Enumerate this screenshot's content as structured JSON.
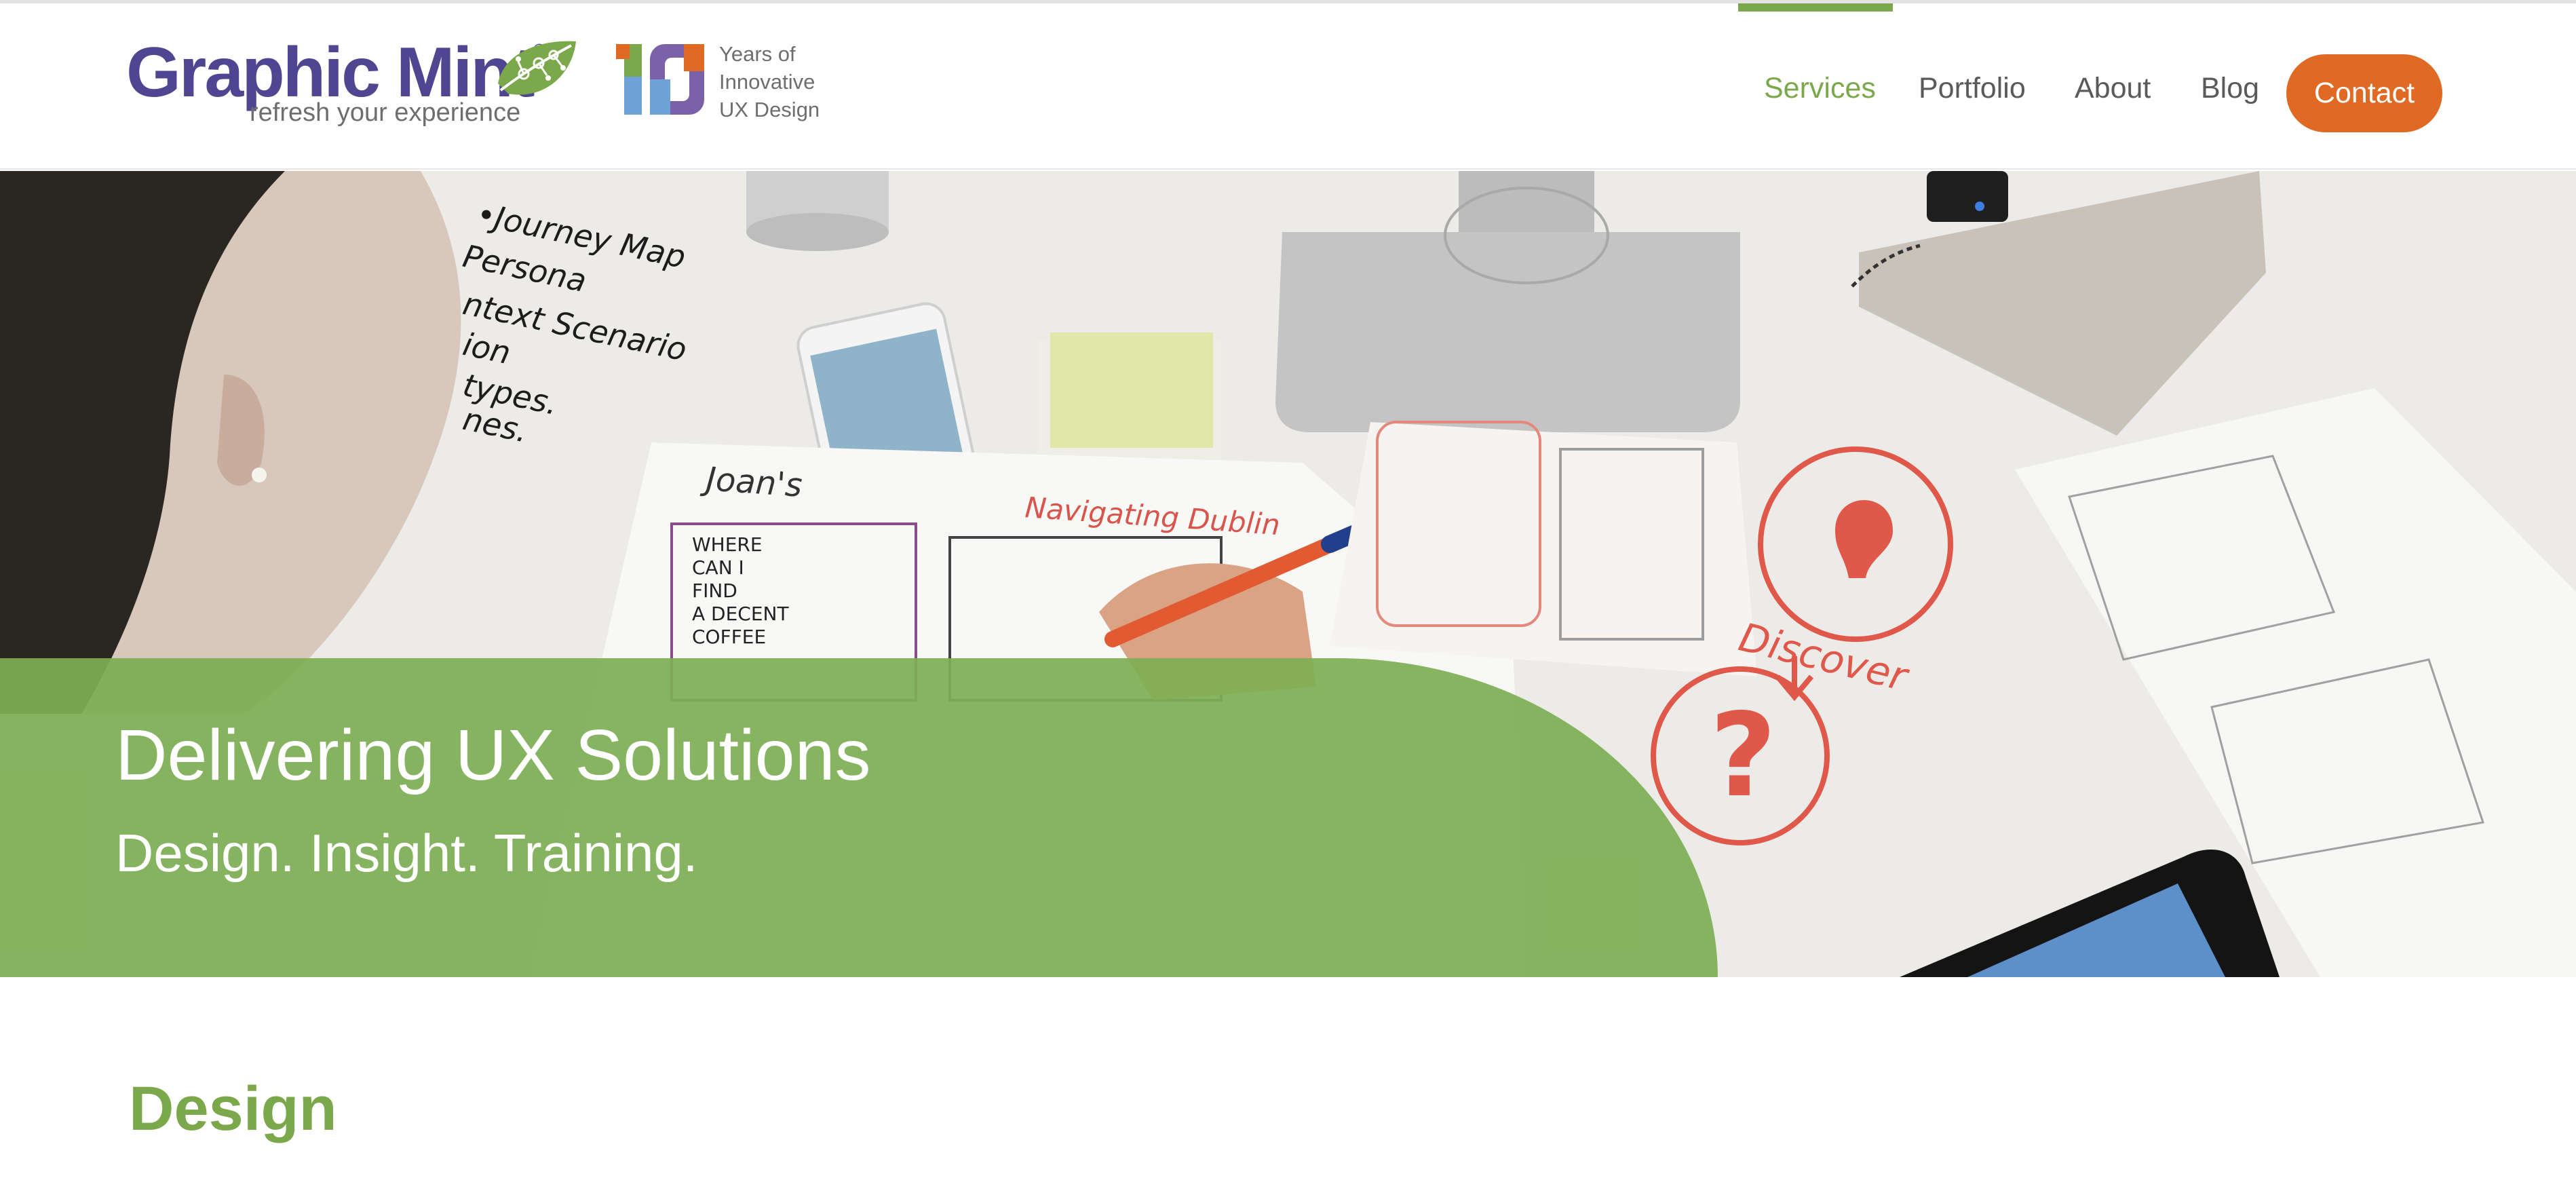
{
  "header": {
    "logo": {
      "wordmark": "Graphic Mint",
      "registered": "®",
      "tagline": "refresh your experience"
    },
    "anniversary": {
      "number": "10",
      "lines": [
        "Years of",
        "Innovative",
        "UX Design"
      ]
    },
    "nav": {
      "items": [
        {
          "label": "Services",
          "active": true
        },
        {
          "label": "Portfolio",
          "active": false
        },
        {
          "label": "About",
          "active": false
        },
        {
          "label": "Blog",
          "active": false
        }
      ],
      "contact_label": "Contact"
    }
  },
  "hero": {
    "title": "Delivering UX Solutions",
    "subtitle": "Design. Insight. Training.",
    "sketch_labels": {
      "notes": [
        "•Journey Map",
        "Persona",
        "ntext Scenario",
        "ion",
        "types.",
        "nes."
      ],
      "joan": "Joan's",
      "navigating": "Navigating Dublin",
      "bubble": [
        "WHERE",
        "CAN I",
        "FIND",
        "A DECENT",
        "COFFEE"
      ],
      "discover": "Discover"
    }
  },
  "section": {
    "title": "Design"
  },
  "colors": {
    "brand_purple": "#4f4591",
    "brand_green": "#7aa84a",
    "contact_orange": "#e06a24",
    "sketch_red": "#e0584a"
  }
}
